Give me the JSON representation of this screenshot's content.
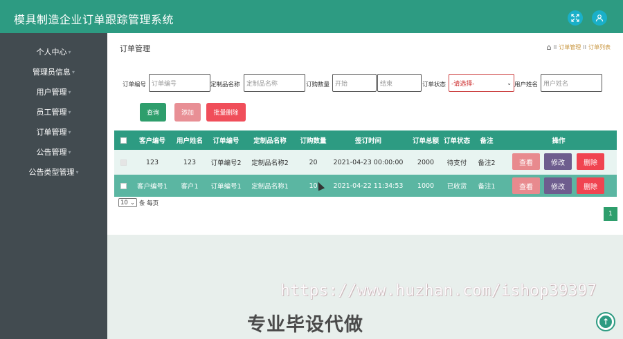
{
  "app": {
    "title": "模具制造企业订单跟踪管理系统"
  },
  "topbar": {
    "fullscreen_icon": "expand-icon",
    "user_icon": "user-icon"
  },
  "sidebar": {
    "items": [
      {
        "label": "个人中心"
      },
      {
        "label": "管理员信息"
      },
      {
        "label": "用户管理"
      },
      {
        "label": "员工管理"
      },
      {
        "label": "订单管理"
      },
      {
        "label": "公告管理"
      },
      {
        "label": "公告类型管理"
      }
    ]
  },
  "page": {
    "title": "订单管理",
    "breadcrumb": [
      "订单管理",
      "订单列表"
    ],
    "breadcrumb_sep": "II"
  },
  "filters": {
    "order_no": {
      "label": "订单编号",
      "placeholder": "订单编号"
    },
    "product_name": {
      "label": "定制品名称",
      "placeholder": "定制品名称"
    },
    "quantity": {
      "label": "订购数量",
      "start_placeholder": "开始",
      "end_placeholder": "结束"
    },
    "status": {
      "label": "订单状态",
      "value": "-请选择-"
    },
    "user_name": {
      "label": "用户姓名",
      "placeholder": "用户姓名"
    }
  },
  "actions": {
    "query": "查询",
    "add": "添加",
    "batch_delete": "批量删除"
  },
  "table": {
    "columns": [
      "客户编号",
      "用户姓名",
      "订单编号",
      "定制品名称",
      "订购数量",
      "签订时间",
      "订单总额",
      "订单状态",
      "备注",
      "操作"
    ],
    "rows": [
      {
        "customer_no": "123",
        "user_name": "123",
        "order_no": "订单编号2",
        "product": "定制品名称2",
        "qty": "20",
        "signed_at": "2021-04-23 00:00:00",
        "total": "2000",
        "status": "待支付",
        "note": "备注2"
      },
      {
        "customer_no": "客户编号1",
        "user_name": "客户1",
        "order_no": "订单编号1",
        "product": "定制品名称1",
        "qty": "10",
        "signed_at": "2021-04-22 11:34:53",
        "total": "1000",
        "status": "已收货",
        "note": "备注1"
      }
    ],
    "row_actions": {
      "view": "查看",
      "edit": "修改",
      "delete": "删除"
    }
  },
  "pager": {
    "page_size": "10",
    "per_page_label": "条 每页",
    "current_page": "1"
  },
  "overlay": {
    "watermark": "https://www.huzhan.com/ishop39397",
    "promo": "专业毕设代做"
  },
  "colors": {
    "primary": "#2d9b82",
    "sidebar": "#424b50"
  }
}
